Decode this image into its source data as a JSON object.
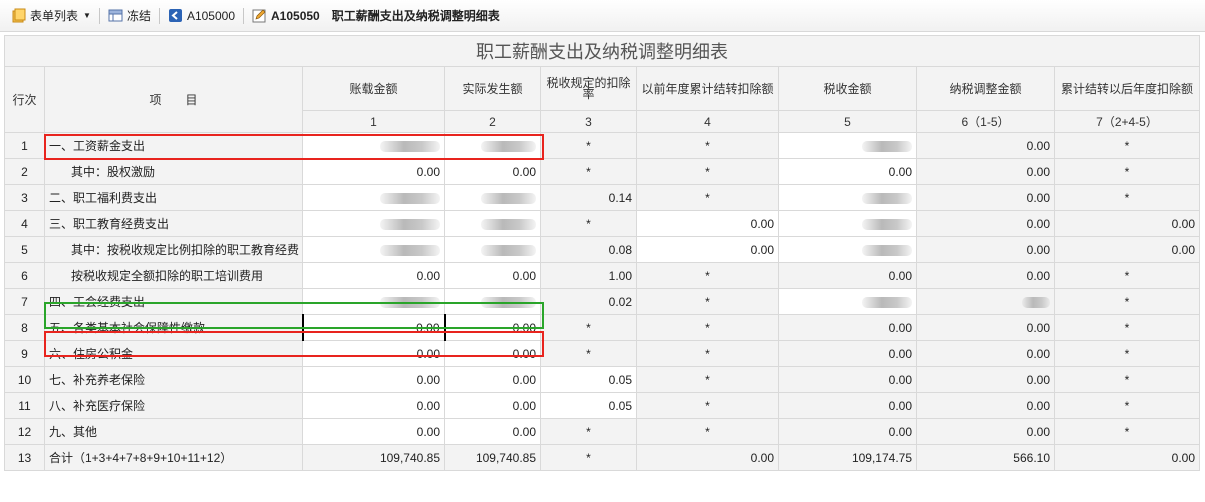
{
  "toolbar": {
    "form_list_label": "表单列表",
    "freeze_label": "冻结",
    "back_label": "A105000",
    "current_code": "A105050",
    "current_title": "职工薪酬支出及纳税调整明细表"
  },
  "table": {
    "title": "职工薪酬支出及纳税调整明细表",
    "headers": {
      "row_no": "行次",
      "item": "项　　目",
      "col1": "账载金额",
      "col2": "实际发生额",
      "col3": "税收规定的扣除率",
      "col4": "以前年度累计结转扣除额",
      "col5": "税收金额",
      "col6": "纳税调整金额",
      "col7": "累计结转以后年度扣除额"
    },
    "header_nums": [
      "1",
      "2",
      "3",
      "4",
      "5",
      "6（1-5）",
      "7（2+4-5）"
    ],
    "rows": [
      {
        "no": "1",
        "item": "一、工资薪金支出",
        "c1": "",
        "c2": "",
        "c3": "*",
        "c4": "*",
        "c5": "",
        "c6": "0.00",
        "c7": "*"
      },
      {
        "no": "2",
        "item": "其中：股权激励",
        "c1": "0.00",
        "c2": "0.00",
        "c3": "*",
        "c4": "*",
        "c5": "0.00",
        "c6": "0.00",
        "c7": "*"
      },
      {
        "no": "3",
        "item": "二、职工福利费支出",
        "c1": "",
        "c2": "",
        "c3": "0.14",
        "c4": "*",
        "c5": "",
        "c6": "0.00",
        "c7": "*"
      },
      {
        "no": "4",
        "item": "三、职工教育经费支出",
        "c1": "",
        "c2": "",
        "c3": "*",
        "c4": "0.00",
        "c5": "",
        "c6": "0.00",
        "c7": "0.00"
      },
      {
        "no": "5",
        "item": "其中：按税收规定比例扣除的职工教育经费",
        "c1": "",
        "c2": "",
        "c3": "0.08",
        "c4": "0.00",
        "c5": "",
        "c6": "0.00",
        "c7": "0.00"
      },
      {
        "no": "6",
        "item": "按税收规定全额扣除的职工培训费用",
        "c1": "0.00",
        "c2": "0.00",
        "c3": "1.00",
        "c4": "*",
        "c5": "0.00",
        "c6": "0.00",
        "c7": "*"
      },
      {
        "no": "7",
        "item": "四、工会经费支出",
        "c1": "",
        "c2": "",
        "c3": "0.02",
        "c4": "*",
        "c5": "",
        "c6": "",
        "c7": "*"
      },
      {
        "no": "8",
        "item": "五、各类基本社会保障性缴款",
        "c1": "0.00",
        "c2": "0.00",
        "c3": "*",
        "c4": "*",
        "c5": "0.00",
        "c6": "0.00",
        "c7": "*"
      },
      {
        "no": "9",
        "item": "六、住房公积金",
        "c1": "0.00",
        "c2": "0.00",
        "c3": "*",
        "c4": "*",
        "c5": "0.00",
        "c6": "0.00",
        "c7": "*"
      },
      {
        "no": "10",
        "item": "七、补充养老保险",
        "c1": "0.00",
        "c2": "0.00",
        "c3": "0.05",
        "c4": "*",
        "c5": "0.00",
        "c6": "0.00",
        "c7": "*"
      },
      {
        "no": "11",
        "item": "八、补充医疗保险",
        "c1": "0.00",
        "c2": "0.00",
        "c3": "0.05",
        "c4": "*",
        "c5": "0.00",
        "c6": "0.00",
        "c7": "*"
      },
      {
        "no": "12",
        "item": "九、其他",
        "c1": "0.00",
        "c2": "0.00",
        "c3": "*",
        "c4": "*",
        "c5": "0.00",
        "c6": "0.00",
        "c7": "*"
      },
      {
        "no": "13",
        "item": "合计（1+3+4+7+8+9+10+11+12）",
        "c1": "109,740.85",
        "c2": "109,740.85",
        "c3": "*",
        "c4": "0.00",
        "c5": "109,174.75",
        "c6": "566.10",
        "c7": "0.00"
      }
    ]
  },
  "colors": {
    "highlight_red": "#e8241e",
    "highlight_green": "#2aa52a",
    "readonly_bg": "#f3f3f3",
    "editable_bg": "#ffffff"
  }
}
